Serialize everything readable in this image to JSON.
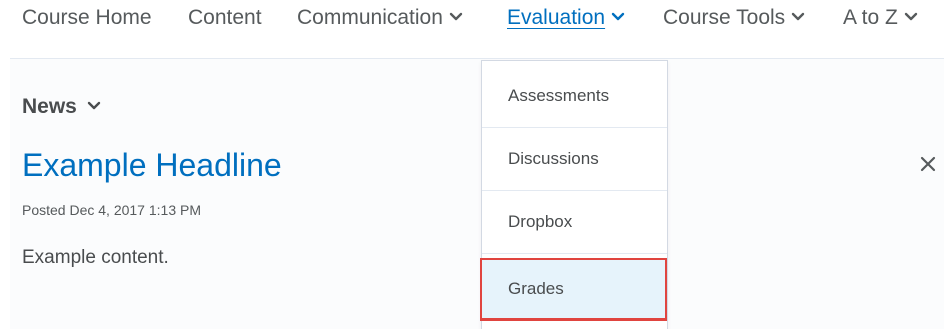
{
  "nav": {
    "items": [
      {
        "label": "Course Home",
        "has_menu": false,
        "active": false
      },
      {
        "label": "Content",
        "has_menu": false,
        "active": false
      },
      {
        "label": "Communication",
        "has_menu": true,
        "active": false
      },
      {
        "label": "Evaluation",
        "has_menu": true,
        "active": true
      },
      {
        "label": "Course Tools",
        "has_menu": true,
        "active": false
      },
      {
        "label": "A to Z",
        "has_menu": true,
        "active": false
      }
    ]
  },
  "dropdown": {
    "items": [
      {
        "label": "Assessments"
      },
      {
        "label": "Discussions"
      },
      {
        "label": "Dropbox"
      },
      {
        "label": "Grades",
        "highlighted": true
      }
    ]
  },
  "news": {
    "widget_title": "News",
    "headline": "Example Headline",
    "posted": "Posted Dec 4, 2017 1:13 PM",
    "content": "Example content."
  },
  "colors": {
    "link_blue": "#006fbf",
    "text_gray": "#494c4e",
    "highlight_fill": "#e6f3fb",
    "highlight_border": "#e0443f"
  },
  "icons": {
    "menu_chevron": "chevron-down-icon",
    "dismiss": "close-icon"
  }
}
